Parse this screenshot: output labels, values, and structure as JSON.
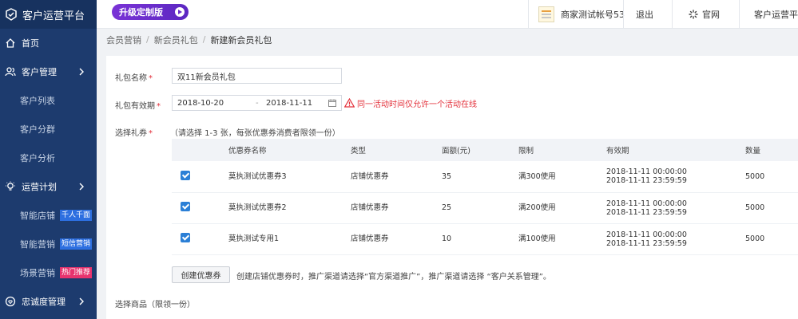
{
  "brand": {
    "title": "客户运营平台"
  },
  "sidebar": {
    "items": [
      {
        "type": "main",
        "label": "首页",
        "icon": "home-icon"
      },
      {
        "type": "main",
        "label": "客户管理",
        "icon": "users-icon",
        "chevron": true
      },
      {
        "type": "sub",
        "label": "客户列表"
      },
      {
        "type": "sub",
        "label": "客户分群"
      },
      {
        "type": "sub",
        "label": "客户分析"
      },
      {
        "type": "main",
        "label": "运营计划",
        "icon": "bulb-icon",
        "chevron": true
      },
      {
        "type": "sub",
        "label": "智能店铺",
        "tag": "千人千面",
        "tag_color": "#2d6fe0"
      },
      {
        "type": "sub",
        "label": "智能营销",
        "tag": "短信营销",
        "tag_color": "#2d6fe0"
      },
      {
        "type": "sub",
        "label": "场景营销",
        "tag": "热门推荐",
        "tag_color": "#e8336e"
      },
      {
        "type": "main",
        "label": "忠诚度管理",
        "icon": "loyalty-icon",
        "chevron": true
      }
    ]
  },
  "topbar": {
    "upgrade_label": "升级定制版",
    "account_name": "商家测试帐号53",
    "logout_label": "退出",
    "official_label": "官网",
    "platform_label": "客户运营平台"
  },
  "breadcrumb": {
    "items": [
      "会员营销",
      "新会员礼包",
      "新建新会员礼包"
    ]
  },
  "form": {
    "name_label": "礼包名称",
    "name_value": "双11新会员礼包",
    "period_label": "礼包有效期",
    "start_date": "2018-10-20",
    "date_separator": "-",
    "end_date": "2018-11-11",
    "warning_text": "同一活动时间仅允许一个活动在线",
    "coupon_label": "选择礼券",
    "coupon_hint": "（请选择 1-3 张，每张优惠券消费者限领一份）",
    "required_mark": "*",
    "goods_label": "选择商品（限领一份）"
  },
  "coupon_table": {
    "headers": [
      "优惠券名称",
      "类型",
      "面额(元)",
      "限制",
      "有效期",
      "数量"
    ],
    "rows": [
      {
        "name": "莫执测试优惠券3",
        "type": "店铺优惠券",
        "amount": "35",
        "limit": "满300使用",
        "valid_from": "2018-11-11 00:00:00",
        "valid_to": "2018-11-11 23:59:59",
        "qty": "5000",
        "checked": true
      },
      {
        "name": "莫执测试优惠券2",
        "type": "店铺优惠券",
        "amount": "25",
        "limit": "满200使用",
        "valid_from": "2018-11-11 00:00:00",
        "valid_to": "2018-11-11 23:59:59",
        "qty": "5000",
        "checked": true
      },
      {
        "name": "莫执测试专用1",
        "type": "店铺优惠券",
        "amount": "10",
        "limit": "满100使用",
        "valid_from": "2018-11-11 00:00:00",
        "valid_to": "2018-11-11 23:59:59",
        "qty": "5000",
        "checked": true
      }
    ]
  },
  "create": {
    "button_label": "创建优惠券",
    "note": "创建店铺优惠券时，推广渠道请选择“官方渠道推广”，推广渠道请选择 “客户关系管理”。"
  }
}
